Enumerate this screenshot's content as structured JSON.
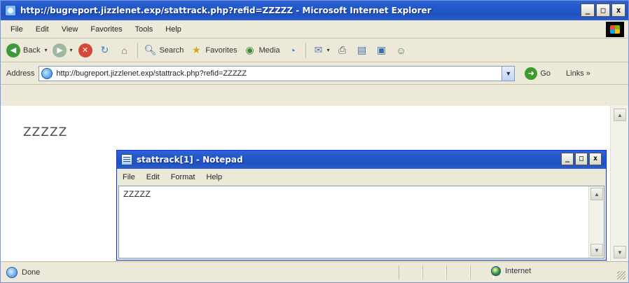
{
  "browser": {
    "title": "http://bugreport.jizzlenet.exp/stattrack.php?refid=ZZZZZ - Microsoft Internet Explorer",
    "window_buttons": {
      "minimize": "_",
      "maximize": "□",
      "close": "x"
    },
    "menu": [
      "File",
      "Edit",
      "View",
      "Favorites",
      "Tools",
      "Help"
    ],
    "toolbar": {
      "back": "Back",
      "search": "Search",
      "favorites": "Favorites",
      "media": "Media"
    },
    "address": {
      "label": "Address",
      "url": "http://bugreport.jizzlenet.exp/stattrack.php?refid=ZZZZZ",
      "go": "Go",
      "links": "Links »"
    },
    "page_text": "ZZZZZ",
    "status": {
      "text": "Done",
      "zone": "Internet"
    }
  },
  "notepad": {
    "title": "stattrack[1] - Notepad",
    "window_buttons": {
      "minimize": "_",
      "maximize": "□",
      "close": "x"
    },
    "menu": [
      "File",
      "Edit",
      "Format",
      "Help"
    ],
    "content": "ZZZZZ"
  }
}
